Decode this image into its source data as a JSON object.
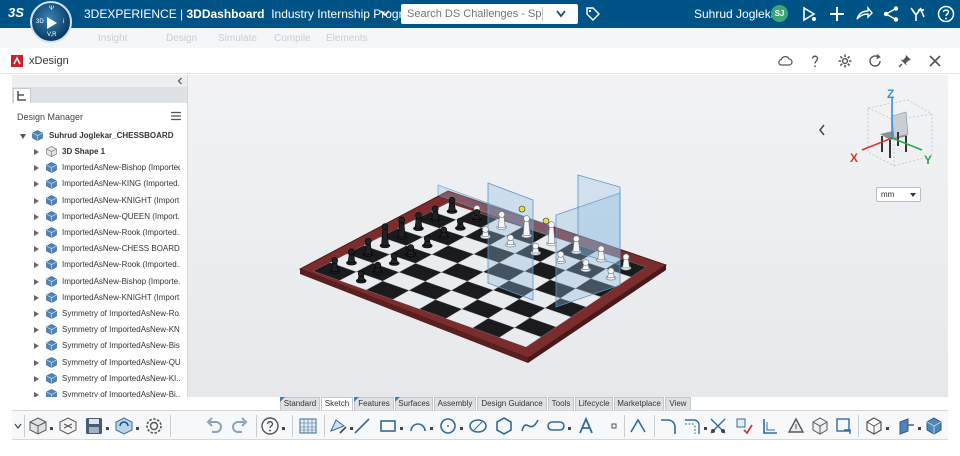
{
  "topbar": {
    "ds_logo": "3S",
    "compass_labels": {
      "top": "Ψ",
      "left": "3D",
      "right": "i",
      "bottom": "V,R"
    },
    "brand": "3DEXPERIENCE | ",
    "app_name": "3DDashboard",
    "title": "Industry Internship Program - ...",
    "search_placeholder": "Search DS Challenges - Sponsors",
    "user_name": "Suhrud Joglekar",
    "user_initials": "SJ"
  },
  "underbar": {
    "items": [
      "Insight",
      "Design",
      "Simulate",
      "Compile",
      "Elements"
    ]
  },
  "panel": {
    "title": "xDesign"
  },
  "tree": {
    "header": "Design Manager",
    "root": "Suhrud Joglekar_CHESSBOARD",
    "items": [
      {
        "label": "3D Shape 1",
        "bold": true
      },
      {
        "label": "ImportedAsNew-Bishop (Imported...",
        "bold": false
      },
      {
        "label": "ImportedAsNew-KING (Imported...",
        "bold": false
      },
      {
        "label": "ImportedAsNew-KNIGHT (Import...",
        "bold": false
      },
      {
        "label": "ImportedAsNew-QUEEN (Import...",
        "bold": false
      },
      {
        "label": "ImportedAsNew-Rook (Imported...",
        "bold": false
      },
      {
        "label": "ImportedAsNew-CHESS BOARD...",
        "bold": false
      },
      {
        "label": "ImportedAsNew-Rook (Imported...",
        "bold": false
      },
      {
        "label": "ImportedAsNew-Bishop (Importe...",
        "bold": false
      },
      {
        "label": "ImportedAsNew-KNIGHT (Import...",
        "bold": false
      },
      {
        "label": "Symmetry of ImportedAsNew-Ro...",
        "bold": false
      },
      {
        "label": "Symmetry of ImportedAsNew-KN...",
        "bold": false
      },
      {
        "label": "Symmetry of ImportedAsNew-Bis...",
        "bold": false
      },
      {
        "label": "Symmetry of ImportedAsNew-QU...",
        "bold": false
      },
      {
        "label": "Symmetry of ImportedAsNew-KI...",
        "bold": false
      },
      {
        "label": "Symmetry of ImportedAsNew-Bi...",
        "bold": false
      }
    ]
  },
  "triad": {
    "x": "X",
    "y": "Y",
    "z": "Z"
  },
  "units": {
    "selected": "mm"
  },
  "action_tabs": [
    "Standard",
    "Sketch",
    "Features",
    "Surfaces",
    "Assembly",
    "Design Guidance",
    "Tools",
    "Lifecycle",
    "Marketplace",
    "View"
  ],
  "colors": {
    "topbar": "#005386",
    "board_frame": "#7b2d2d",
    "plane": "#8fbce0",
    "accent": "#3a7fc0"
  }
}
